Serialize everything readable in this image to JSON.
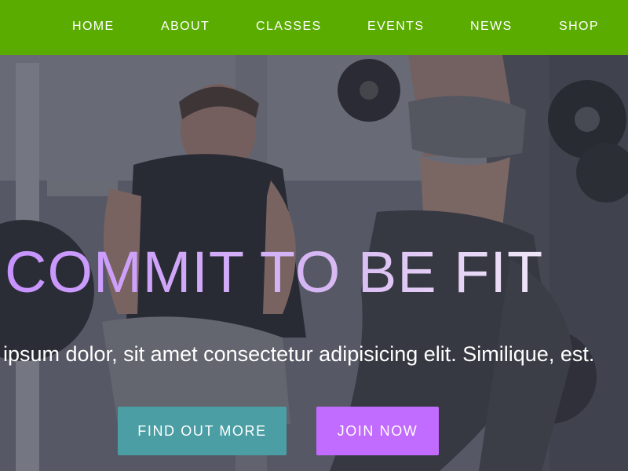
{
  "nav": {
    "items": [
      "HOME",
      "ABOUT",
      "CLASSES",
      "EVENTS",
      "NEWS",
      "SHOP"
    ],
    "background_color": "#5aac00"
  },
  "hero": {
    "headline": "COMMIT TO BE FIT",
    "subtitle": "ipsum dolor, sit amet consectetur adipisicing elit. Similique, est.",
    "primary_button": "FIND OUT MORE",
    "secondary_button": "JOIN NOW",
    "primary_button_color": "#4a9ea4",
    "secondary_button_color": "#c26bff"
  }
}
